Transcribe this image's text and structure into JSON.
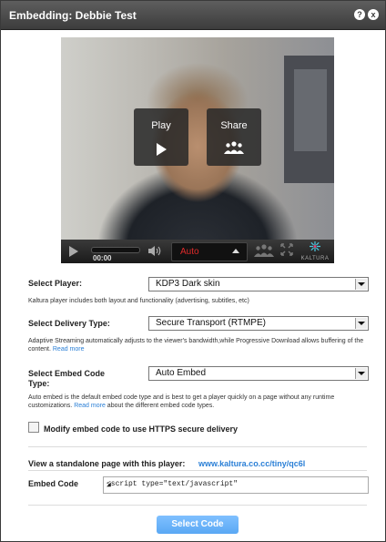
{
  "dialog": {
    "title": "Embedding: Debbie Test",
    "help_glyph": "?",
    "close_glyph": "x"
  },
  "player": {
    "overlay_play_label": "Play",
    "overlay_share_label": "Share",
    "time": "00:00",
    "flavor": "Auto",
    "flavor_color": "#e02a2a",
    "brand": "KALTURA",
    "icons": [
      "play-icon",
      "share-people-icon",
      "volume-icon",
      "fullscreen-icon",
      "kaltura-logo-icon"
    ]
  },
  "form": {
    "select_player_label": "Select Player:",
    "select_player_value": "KDP3 Dark skin",
    "select_player_desc": "Kaltura player includes both layout and functionality (advertising, subtitles, etc)",
    "delivery_label": "Select Delivery Type:",
    "delivery_value": "Secure Transport (RTMPE)",
    "delivery_desc": "Adaptive Streaming automatically adjusts to the viewer's bandwidth,while Progressive Download allows buffering of the content.",
    "delivery_read_more": "Read more",
    "embed_type_label_1": "Select Embed Code",
    "embed_type_label_2": "Type:",
    "embed_type_value": "Auto Embed",
    "embed_type_desc_1": "Auto embed is the default embed code type and is best to get a player quickly on a page without any runtime customizations.",
    "embed_type_read_more": "Read more",
    "embed_type_desc_2": "about the different embed code types.",
    "https_label": "Modify embed code to use HTTPS secure delivery",
    "standalone_label": "View a standalone page with this player:",
    "standalone_link": "www.kaltura.co.cc/tiny/qc6l",
    "embed_code_label": "Embed Code",
    "embed_code_value": "<script type=\"text/javascript\"",
    "select_code_button": "Select Code",
    "link_color": "#2a7fd6",
    "button_color": "#5aa8f4"
  }
}
